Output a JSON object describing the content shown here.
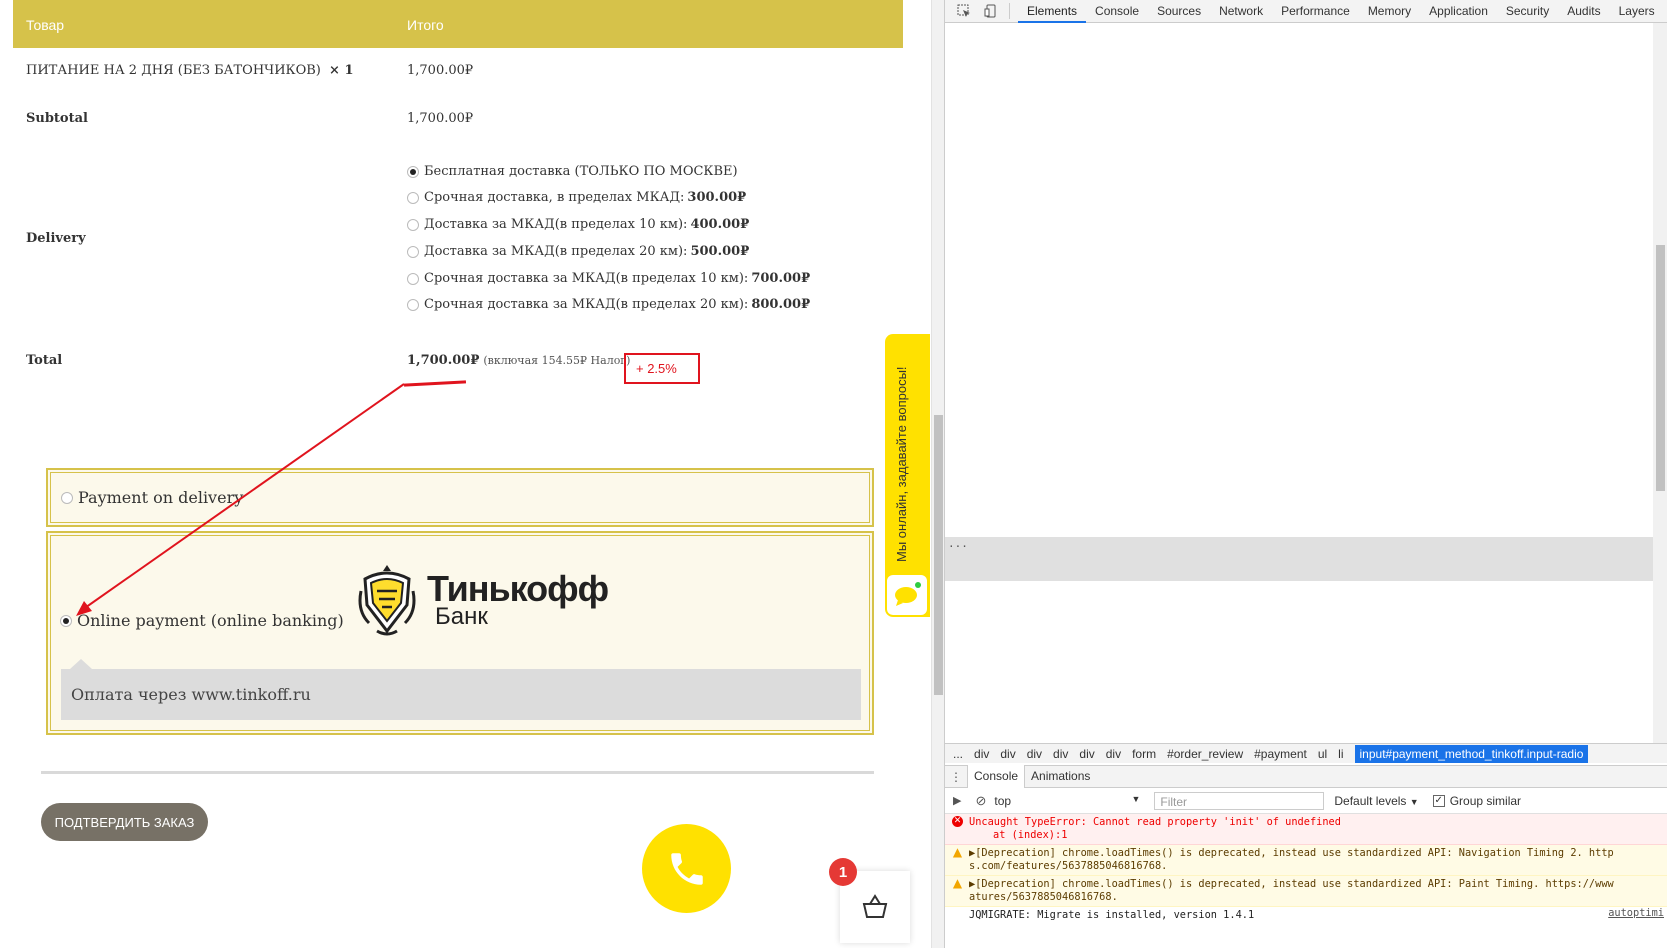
{
  "checkout": {
    "col_product": "Товар",
    "col_total": "Итого",
    "item_name": "ПИТАНИЕ НА 2 ДНЯ (БЕЗ БАТОНЧИКОВ)",
    "item_qty": "× 1",
    "item_price": "1,700.00₽",
    "subtotal_label": "Subtotal",
    "subtotal_value": "1,700.00₽",
    "delivery_label": "Delivery",
    "shipping_options": [
      {
        "label": "Бесплатная доставка (ТОЛЬКО ПО МОСКВЕ)",
        "price": "",
        "selected": true
      },
      {
        "label": "Срочная доставка, в пределах МКАД:",
        "price": "300.00₽",
        "selected": false
      },
      {
        "label": "Доставка за МКАД(в пределах 10 км):",
        "price": "400.00₽",
        "selected": false
      },
      {
        "label": "Доставка за МКАД(в пределах 20 км):",
        "price": "500.00₽",
        "selected": false
      },
      {
        "label": "Срочная доставка за МКАД(в пределах 10 км):",
        "price": "700.00₽",
        "selected": false
      },
      {
        "label": "Срочная доставка за МКАД(в пределах 20 км):",
        "price": "800.00₽",
        "selected": false
      }
    ],
    "total_label": "Total",
    "total_value": "1,700.00₽",
    "total_tax_note": "(включая 154.55₽ Налог)",
    "annotation": "+ 2.5%",
    "payment_cod_label": "Payment on delivery",
    "payment_tinkoff_label": "Online payment (online banking)",
    "tinkoff_logo_name": "Тинькофф",
    "tinkoff_logo_sub": "Банк",
    "tinkoff_description": "Оплата через www.tinkoff.ru",
    "confirm_button": "ПОДТВЕРДИТЬ ЗАКАЗ",
    "chat_tab_text": "Мы онлайн, задавайте вопросы!",
    "cart_count": "1",
    "colors": {
      "accent": "#d6c24a",
      "call_button": "#ffe100",
      "annotation": "#e0141e",
      "badge": "#e53935"
    }
  },
  "devtools": {
    "tabs": [
      "Elements",
      "Console",
      "Sources",
      "Network",
      "Performance",
      "Memory",
      "Application",
      "Security",
      "Audits",
      "Layers"
    ],
    "breadcrumbs": [
      "...",
      "div",
      "div",
      "div",
      "div",
      "div",
      "div",
      "form",
      "#order_review",
      "#payment",
      "ul",
      "li"
    ],
    "breadcrumb_current": "input#payment_method_tinkoff.input-radio",
    "drawer_tabs": [
      "Console",
      "Animations"
    ],
    "console_context": "top",
    "console_filter_placeholder": "Filter",
    "console_levels": "Default levels",
    "console_group_similar": "Group similar",
    "messages": [
      {
        "type": "error",
        "text": "Uncaught TypeError: Cannot read property 'init' of undefined",
        "line2": "at (index):1",
        "src": ""
      },
      {
        "type": "warn",
        "text": "▶[Deprecation] chrome.loadTimes() is deprecated, instead use standardized API: Navigation Timing 2. http",
        "line2": "s.com/features/5637885046816768.",
        "src": ""
      },
      {
        "type": "warn",
        "text": "▶[Deprecation] chrome.loadTimes() is deprecated, instead use standardized API: Paint Timing. https://www",
        "line2": "atures/5637885046816768.",
        "src": ""
      },
      {
        "type": "log",
        "text": "JQMIGRATE: Migrate is installed, version 1.4.1",
        "line2": "",
        "src": "autoptimi"
      }
    ]
  }
}
